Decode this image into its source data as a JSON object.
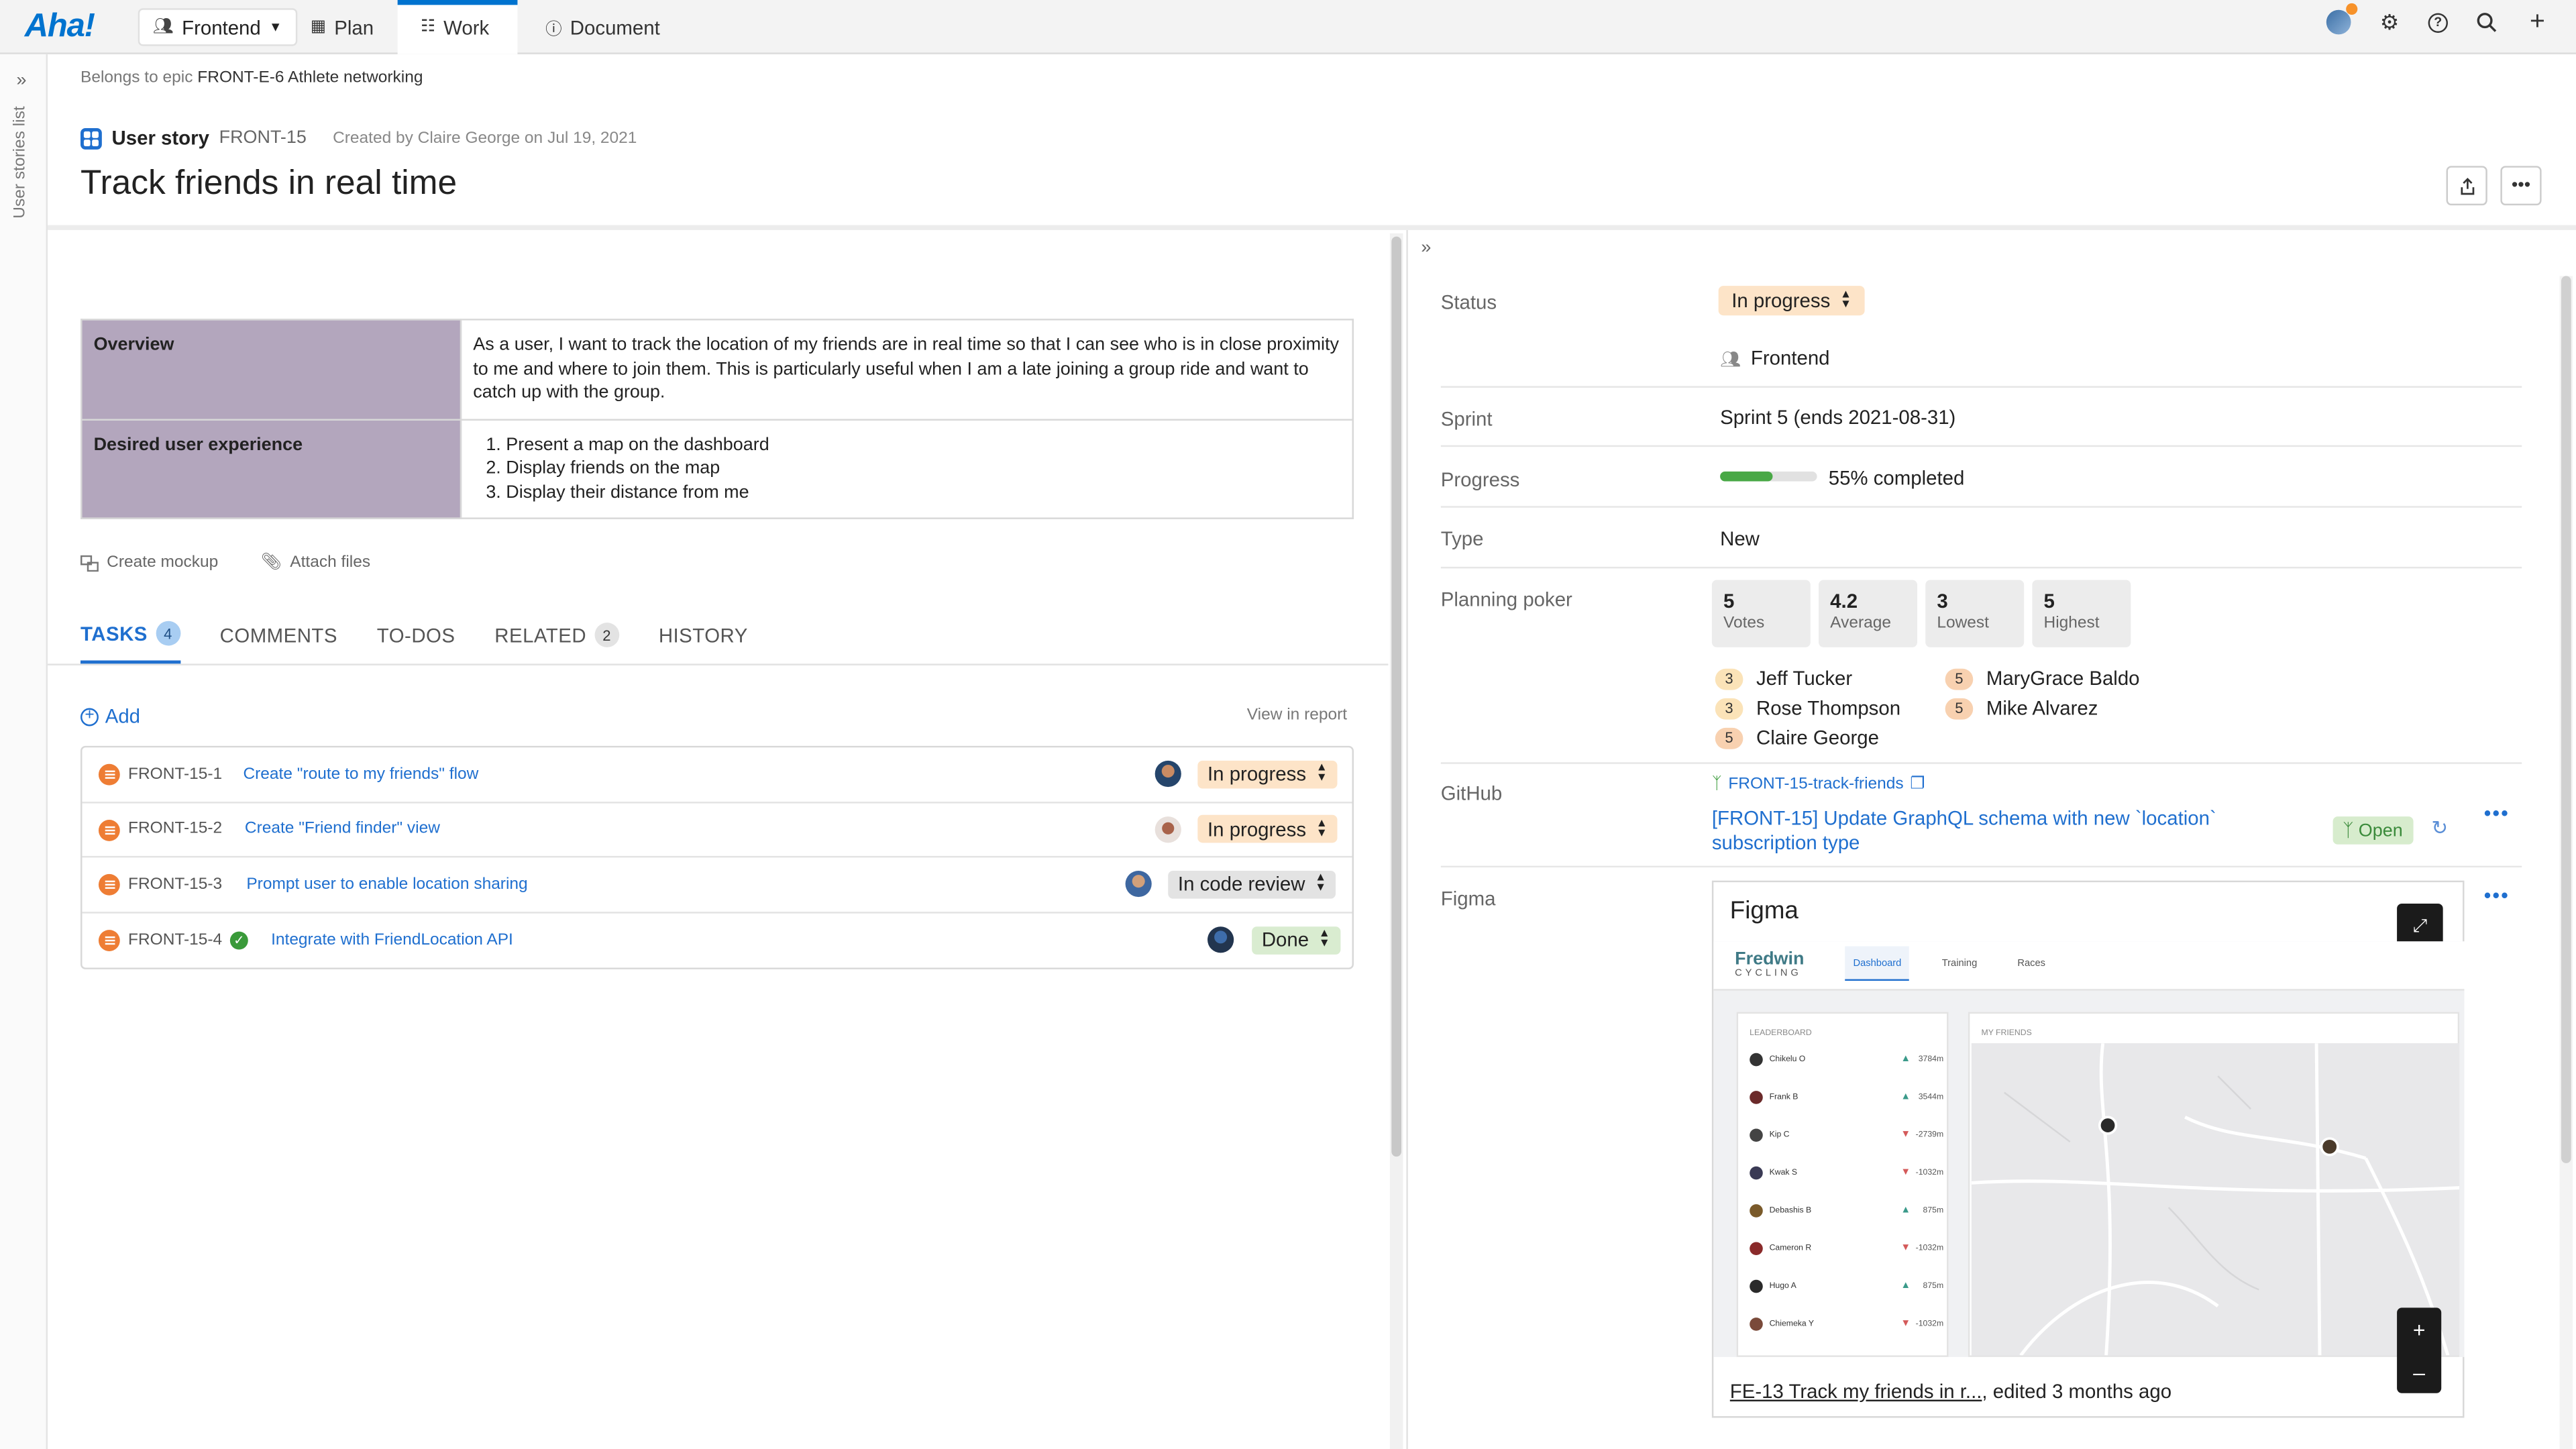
{
  "nav": {
    "logo": "Aha!",
    "workspace": "Frontend",
    "tabs": [
      {
        "label": "Plan",
        "icon": "calendar-icon"
      },
      {
        "label": "Work",
        "icon": "grid-icon"
      },
      {
        "label": "Document",
        "icon": "info-icon"
      }
    ],
    "right_icons": [
      "avatar",
      "gear-icon",
      "help-icon",
      "search-icon",
      "plus-icon"
    ],
    "accent": "#0073cf"
  },
  "rail": {
    "label": "User stories list"
  },
  "header": {
    "breadcrumb_prefix": "Belongs to epic",
    "breadcrumb_epic": "FRONT-E-6 Athlete networking",
    "record_type": "User story",
    "record_id": "FRONT-15",
    "created": "Created by Claire George on Jul 19, 2021",
    "title": "Track friends in real time"
  },
  "description": {
    "rows": [
      {
        "label": "Overview",
        "text": "As a user, I want to track the location of my friends are in real time so that I can see who is in close proximity to me and  where to join them. This is particularly useful when I am a late joining a group ride and want to catch up with the group."
      },
      {
        "label": "Desired user experience",
        "items": [
          "Present a map on the dashboard",
          "Display friends on the map",
          "Display their distance from me"
        ]
      }
    ]
  },
  "attach": {
    "mockup": "Create mockup",
    "files": "Attach files"
  },
  "tabs": [
    {
      "label": "TASKS",
      "count": "4"
    },
    {
      "label": "COMMENTS",
      "count": ""
    },
    {
      "label": "TO-DOS",
      "count": ""
    },
    {
      "label": "RELATED",
      "count": "2"
    },
    {
      "label": "HISTORY",
      "count": ""
    }
  ],
  "tasks_panel": {
    "add": "Add",
    "view_report": "View in report"
  },
  "tasks": [
    {
      "id": "FRONT-15-1",
      "name": "Create \"route to my friends\" flow",
      "status": "In progress"
    },
    {
      "id": "FRONT-15-2",
      "name": "Create \"Friend finder\" view",
      "status": "In progress"
    },
    {
      "id": "FRONT-15-3",
      "name": "Prompt user to enable location sharing",
      "status": "In code review"
    },
    {
      "id": "FRONT-15-4",
      "name": "Integrate with FriendLocation API",
      "status": "Done"
    }
  ],
  "fields": {
    "status_label": "Status",
    "status_value": "In progress",
    "team": "Frontend",
    "sprint_label": "Sprint",
    "sprint_value": "Sprint 5 (ends 2021-08-31)",
    "progress_label": "Progress",
    "progress_value": 55,
    "progress_text": "55% completed",
    "type_label": "Type",
    "type_value": "New",
    "poker_label": "Planning poker",
    "github_label": "GitHub",
    "figma_label": "Figma"
  },
  "poker": {
    "cards": [
      {
        "n": "5",
        "l": "Votes"
      },
      {
        "n": "4.2",
        "l": "Average"
      },
      {
        "n": "3",
        "l": "Lowest"
      },
      {
        "n": "5",
        "l": "Highest"
      }
    ],
    "voters": [
      {
        "score": "3",
        "name": "Jeff Tucker"
      },
      {
        "score": "5",
        "name": "MaryGrace Baldo"
      },
      {
        "score": "3",
        "name": "Rose Thompson"
      },
      {
        "score": "5",
        "name": "Mike Alvarez"
      },
      {
        "score": "5",
        "name": "Claire George"
      }
    ]
  },
  "github": {
    "branch": "FRONT-15-track-friends",
    "pr": "[FRONT-15] Update GraphQL schema with new `location` subscription type",
    "pr_state": "Open"
  },
  "figma": {
    "title": "Figma",
    "brand": "Fredwin",
    "brand_sub": "CYCLING",
    "mock_tabs": [
      "Dashboard",
      "Training",
      "Races"
    ],
    "leaderboard_title": "LEADERBOARD",
    "friends_title": "MY FRIENDS",
    "leaderboard": [
      {
        "name": "Chikelu O",
        "dist": "3784m",
        "up": true
      },
      {
        "name": "Frank B",
        "dist": "3544m",
        "up": true
      },
      {
        "name": "Kip C",
        "dist": "-2739m",
        "up": false
      },
      {
        "name": "Kwak S",
        "dist": "-1032m",
        "up": false
      },
      {
        "name": "Debashis B",
        "dist": "875m",
        "up": true
      },
      {
        "name": "Cameron R",
        "dist": "-1032m",
        "up": false
      },
      {
        "name": "Hugo A",
        "dist": "875m",
        "up": true
      },
      {
        "name": "Chiemeka Y",
        "dist": "-1032m",
        "up": false
      }
    ],
    "footer_link": "FE-13 Track my friends in r...",
    "footer_rest": ", edited 3 months ago"
  }
}
